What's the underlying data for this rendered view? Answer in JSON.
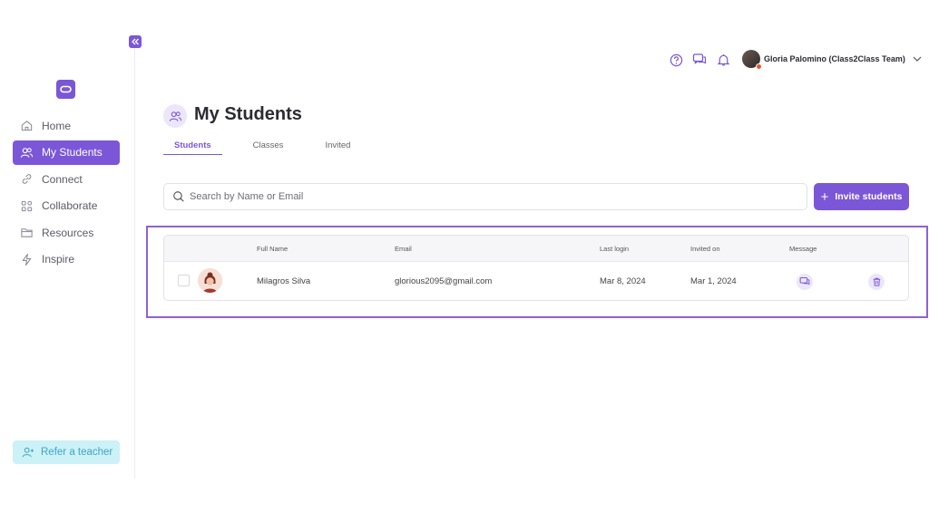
{
  "sidebar": {
    "logo_icon": "class2class-logo-icon",
    "collapse_icon": "double-chevron-left-icon",
    "items": [
      {
        "label": "Home",
        "icon": "home-icon",
        "active": false
      },
      {
        "label": "My Students",
        "icon": "students-icon",
        "active": true
      },
      {
        "label": "Connect",
        "icon": "link-icon",
        "active": false
      },
      {
        "label": "Collaborate",
        "icon": "grid-icon",
        "active": false
      },
      {
        "label": "Resources",
        "icon": "folder-icon",
        "active": false
      },
      {
        "label": "Inspire",
        "icon": "lightning-icon",
        "active": false
      }
    ],
    "refer_label": "Refer a teacher"
  },
  "header": {
    "icons": [
      "help-icon",
      "chat-icon",
      "bell-icon"
    ],
    "user_name": "Gloria Palomino (Class2Class Team)"
  },
  "main": {
    "title": "My Students",
    "tabs": [
      {
        "label": "Students",
        "active": true
      },
      {
        "label": "Classes",
        "active": false
      },
      {
        "label": "Invited",
        "active": false
      }
    ],
    "search_placeholder": "Search by Name or Email",
    "invite_plus": "+",
    "invite_label": "Invite students",
    "table": {
      "headers": {
        "full_name": "Full Name",
        "email": "Email",
        "last_login": "Last login",
        "invited_on": "Invited on",
        "message": "Message"
      },
      "rows": [
        {
          "full_name": "Milagros Silva",
          "email": "glorious2095@gmail.com",
          "last_login": "Mar 8, 2024",
          "invited_on": "Mar 1, 2024"
        }
      ]
    }
  },
  "colors": {
    "accent": "#7b57d8",
    "accent_light": "#ece6fb",
    "refer_bg": "#ccf1f6",
    "highlight_border": "#8d62d4"
  }
}
